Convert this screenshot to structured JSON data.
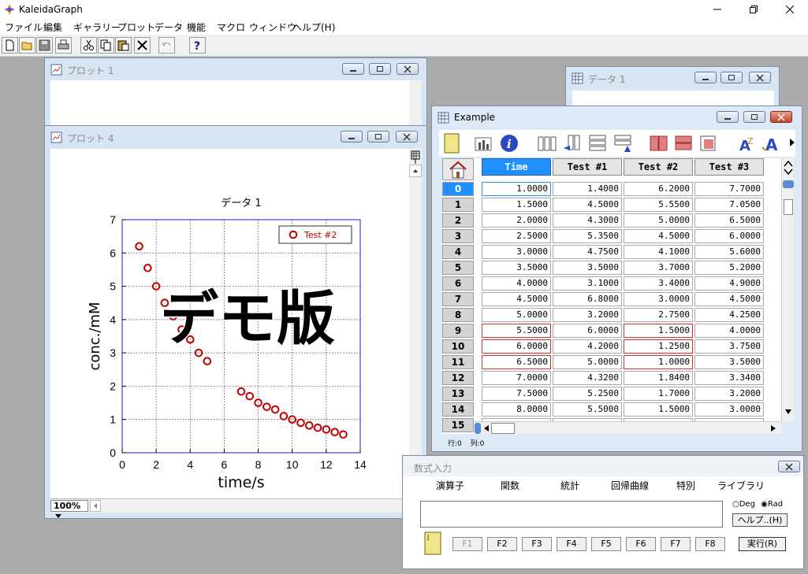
{
  "app": {
    "title": "KaleidaGraph",
    "menus": [
      "ファイル",
      "編集",
      "ギャラリー",
      "プロット",
      "データ",
      "機能",
      "マクロ",
      "ウィンドウ",
      "ヘルプ(H)"
    ]
  },
  "toolbar": {
    "buttons": [
      "new-file-icon",
      "open-folder-icon",
      "save-icon",
      "print-icon",
      "cut-icon",
      "copy-icon",
      "paste-icon",
      "delete-icon",
      "undo-icon",
      "help-icon"
    ]
  },
  "windows": {
    "plot1": {
      "title": "プロット 1"
    },
    "data1": {
      "title": "データ 1"
    },
    "plot4": {
      "title": "プロット 4",
      "zoom": "100%"
    },
    "example": {
      "title": "Example",
      "columns": [
        "Time",
        "Test #1",
        "Test #2",
        "Test #3"
      ],
      "rows": [
        {
          "n": "0",
          "v": [
            "1.0000",
            "1.4000",
            "6.2000",
            "7.7000"
          ]
        },
        {
          "n": "1",
          "v": [
            "1.5000",
            "4.5000",
            "5.5500",
            "7.0500"
          ]
        },
        {
          "n": "2",
          "v": [
            "2.0000",
            "4.3000",
            "5.0000",
            "6.5000"
          ]
        },
        {
          "n": "3",
          "v": [
            "2.5000",
            "5.3500",
            "4.5000",
            "6.0000"
          ]
        },
        {
          "n": "4",
          "v": [
            "3.0000",
            "4.7500",
            "4.1000",
            "5.6000"
          ]
        },
        {
          "n": "5",
          "v": [
            "3.5000",
            "3.5000",
            "3.7000",
            "5.2000"
          ]
        },
        {
          "n": "6",
          "v": [
            "4.0000",
            "3.1000",
            "3.4000",
            "4.9000"
          ]
        },
        {
          "n": "7",
          "v": [
            "4.5000",
            "6.8000",
            "3.0000",
            "4.5000"
          ]
        },
        {
          "n": "8",
          "v": [
            "5.0000",
            "3.2000",
            "2.7500",
            "4.2500"
          ]
        },
        {
          "n": "9",
          "v": [
            "5.5000",
            "6.0000",
            "1.5000",
            "4.0000"
          ]
        },
        {
          "n": "10",
          "v": [
            "6.0000",
            "4.2000",
            "1.2500",
            "3.7500"
          ]
        },
        {
          "n": "11",
          "v": [
            "6.5000",
            "5.0000",
            "1.0000",
            "3.5000"
          ]
        },
        {
          "n": "12",
          "v": [
            "7.0000",
            "4.3200",
            "1.8400",
            "3.3400"
          ]
        },
        {
          "n": "13",
          "v": [
            "7.5000",
            "5.2500",
            "1.7000",
            "3.2000"
          ]
        },
        {
          "n": "14",
          "v": [
            "8.0000",
            "5.5000",
            "1.5000",
            "3.0000"
          ]
        },
        {
          "n": "15",
          "v": [
            "",
            "",
            "",
            ""
          ]
        }
      ],
      "status_row": "行:0",
      "status_col": "列:0"
    },
    "formula": {
      "title": "数式入力",
      "tabs": [
        "演算子",
        "関数",
        "統計",
        "回帰曲線",
        "特別",
        "ライブラリ"
      ],
      "deg_label": "Deg",
      "rad_label": "Rad",
      "angle_mode": "Rad",
      "help_button": "ヘルプ..(H)",
      "fkeys": [
        "F1",
        "F2",
        "F3",
        "F4",
        "F5",
        "F6",
        "F7",
        "F8"
      ],
      "run_button": "実行(R)"
    }
  },
  "colors": {
    "accent": "#1e90ff",
    "series": "#c00000",
    "axis": "#1a1acc"
  },
  "chart_data": {
    "type": "scatter",
    "title": "データ 1",
    "xlabel": "time/s",
    "ylabel": "conc./mM",
    "xlim": [
      0,
      14
    ],
    "ylim": [
      0,
      7
    ],
    "xticks": [
      0,
      2,
      4,
      6,
      8,
      10,
      12,
      14
    ],
    "yticks": [
      0,
      1,
      2,
      3,
      4,
      5,
      6,
      7
    ],
    "grid": true,
    "legend_position": "top-right",
    "watermark": "デモ版",
    "series": [
      {
        "name": "Test #2",
        "x": [
          1.0,
          1.5,
          2.0,
          2.5,
          3.0,
          3.5,
          4.0,
          4.5,
          5.0,
          7.0,
          7.5,
          8.0,
          8.5,
          9.0,
          9.5,
          10.0,
          10.5,
          11.0,
          11.5,
          12.0,
          12.5,
          13.0
        ],
        "y": [
          6.2,
          5.55,
          5.0,
          4.5,
          4.1,
          3.7,
          3.4,
          3.0,
          2.75,
          1.84,
          1.7,
          1.5,
          1.38,
          1.3,
          1.1,
          1.0,
          0.9,
          0.82,
          0.75,
          0.7,
          0.62,
          0.55
        ]
      }
    ]
  }
}
